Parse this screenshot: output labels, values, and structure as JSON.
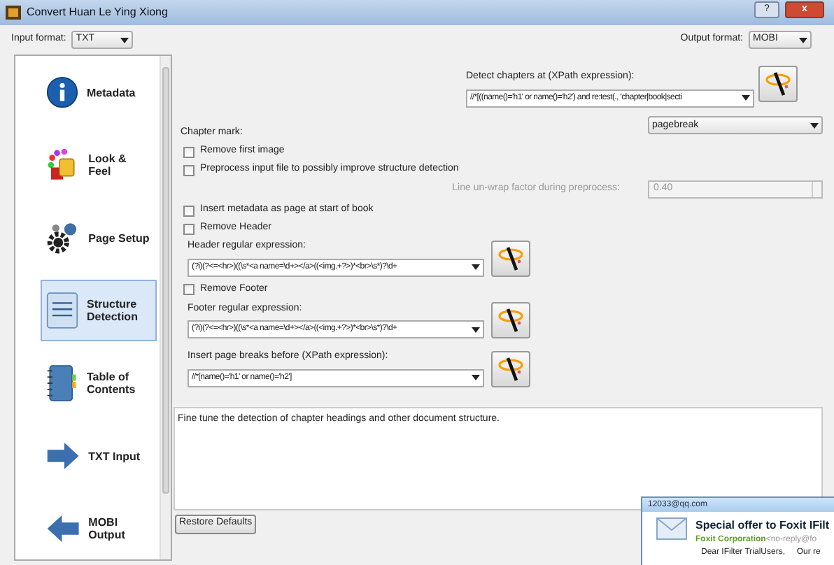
{
  "window": {
    "title": "Convert Huan Le Ying Xiong",
    "buttons": [
      "?",
      "x"
    ]
  },
  "input_format": {
    "label": "Input format:",
    "value": "TXT"
  },
  "output_format": {
    "label": "Output format:",
    "value": "MOBI"
  },
  "sidebar": {
    "items": [
      {
        "label": "Metadata",
        "selected": false
      },
      {
        "label": "Look & Feel",
        "selected": false
      },
      {
        "label": "Page Setup",
        "selected": false
      },
      {
        "label": "Structure Detection",
        "selected": true
      },
      {
        "label": "Table of Contents",
        "selected": false
      },
      {
        "label": "TXT Input",
        "selected": false
      },
      {
        "label": "MOBI Output",
        "selected": false
      }
    ]
  },
  "detect_chapters": {
    "label": "Detect chapters at (XPath expression):",
    "value": "//*[((name()='h1' or name()='h2') and re:test(., 'chapter|book|secti"
  },
  "chapter_mark": {
    "label": "Chapter mark:",
    "value": "pagebreak"
  },
  "options_a": [
    {
      "label": "Remove first image",
      "checked": false
    },
    {
      "label": "Preprocess input file to possibly improve structure detection",
      "checked": false
    }
  ],
  "unwrap": {
    "label": "Line un-wrap factor during preprocess:",
    "value": "0.40",
    "disabled": true
  },
  "options_b": [
    {
      "label": "Insert metadata as page at start of book",
      "checked": false
    },
    {
      "label": "Remove Header",
      "checked": false
    }
  ],
  "header_regex": {
    "label": "Header regular expression:",
    "value": "(?i)(?<=<hr>)((\\s*<a name=\\d+></a>((<img.+?>)*<br>\\s*)?\\d+"
  },
  "remove_footer": {
    "label": "Remove Footer",
    "checked": false
  },
  "footer_regex": {
    "label": "Footer regular expression:",
    "value": "(?i)(?<=<hr>)((\\s*<a name=\\d+></a>((<img.+?>)*<br>\\s*)?\\d+"
  },
  "page_breaks": {
    "label": "Insert page breaks before (XPath expression):",
    "value": "//*[name()='h1' or name()='h2']"
  },
  "help_text": "Fine tune the detection of chapter headings and other document structure.",
  "restore_button": "Restore Defaults",
  "notification": {
    "account": "12033@qq.com",
    "subject": "Special offer to Foxit IFilt",
    "sender": "Foxit Corporation",
    "address": "<no-reply@fo",
    "preview": "Dear IFilter TrialUsers,     Our re"
  }
}
